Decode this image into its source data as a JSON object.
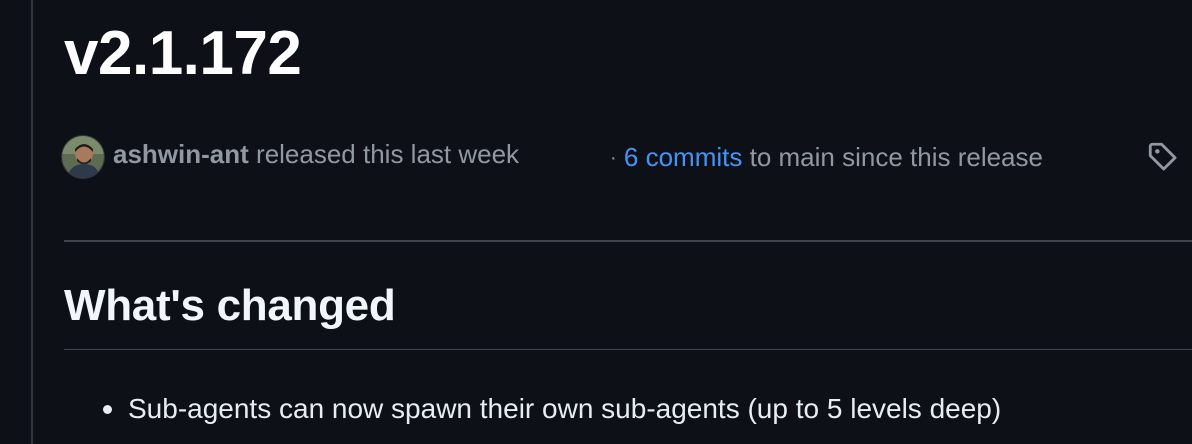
{
  "release": {
    "title": "v2.1.172"
  },
  "meta": {
    "author": "ashwin-ant",
    "released_text": "released this last week",
    "separator": "·",
    "commits_link": "6 commits",
    "commits_suffix": "to main since this release"
  },
  "icons": {
    "avatar": "user-avatar",
    "tag": "tag-icon"
  },
  "section": {
    "heading": "What's changed"
  },
  "changes": [
    "Sub-agents can now spawn their own sub-agents (up to 5 levels deep)"
  ],
  "colors": {
    "background": "#0d1117",
    "text": "#e6edf3",
    "muted": "#9198a1",
    "link": "#4493f8",
    "border": "#3d444d"
  }
}
